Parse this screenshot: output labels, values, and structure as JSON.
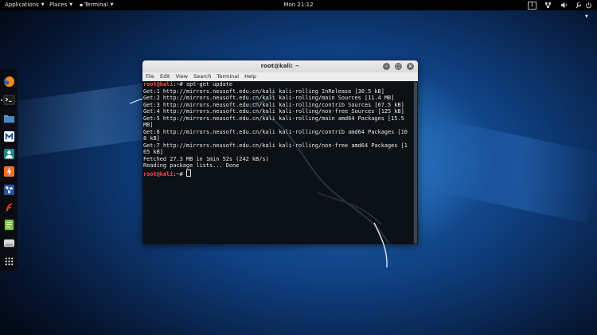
{
  "topbar": {
    "applications": "Applications",
    "places": "Places",
    "terminal": "Terminal",
    "clock": "Mon 21:12",
    "workspace": "1"
  },
  "dock": {
    "items": [
      "firefox-icon",
      "terminal-icon",
      "files-icon",
      "metasploit-icon",
      "armitage-icon",
      "burpsuite-icon",
      "maltego-icon",
      "faraday-icon",
      "leafpad-icon",
      "disks-icon",
      "show-apps-icon"
    ]
  },
  "window": {
    "title": "root@kali: ~",
    "menu": [
      "File",
      "Edit",
      "View",
      "Search",
      "Terminal",
      "Help"
    ]
  },
  "terminal": {
    "prompt": "root@kali",
    "prompt_suffix": ":~# ",
    "command": "apt-get update",
    "output": [
      "Get:1 http://mirrors.neusoft.edu.cn/kali kali-rolling InRelease [30.5 kB]",
      "Get:2 http://mirrors.neusoft.edu.cn/kali kali-rolling/main Sources [11.4 MB]",
      "Get:3 http://mirrors.neusoft.edu.cn/kali kali-rolling/contrib Sources [67.5 kB]",
      "Get:4 http://mirrors.neusoft.edu.cn/kali kali-rolling/non-free Sources [125 kB]",
      "Get:5 http://mirrors.neusoft.edu.cn/kali kali-rolling/main amd64 Packages [15.5",
      "MB]",
      "Get:6 http://mirrors.neusoft.edu.cn/kali kali-rolling/contrib amd64 Packages [10",
      "8 kB]",
      "Get:7 http://mirrors.neusoft.edu.cn/kali kali-rolling/non-free amd64 Packages [1",
      "65 kB]",
      "Fetched 27.3 MB in 1min 52s (242 kB/s)",
      "Reading package lists... Done"
    ],
    "prompt2": "root@kali",
    "prompt2_suffix": ":~# "
  }
}
